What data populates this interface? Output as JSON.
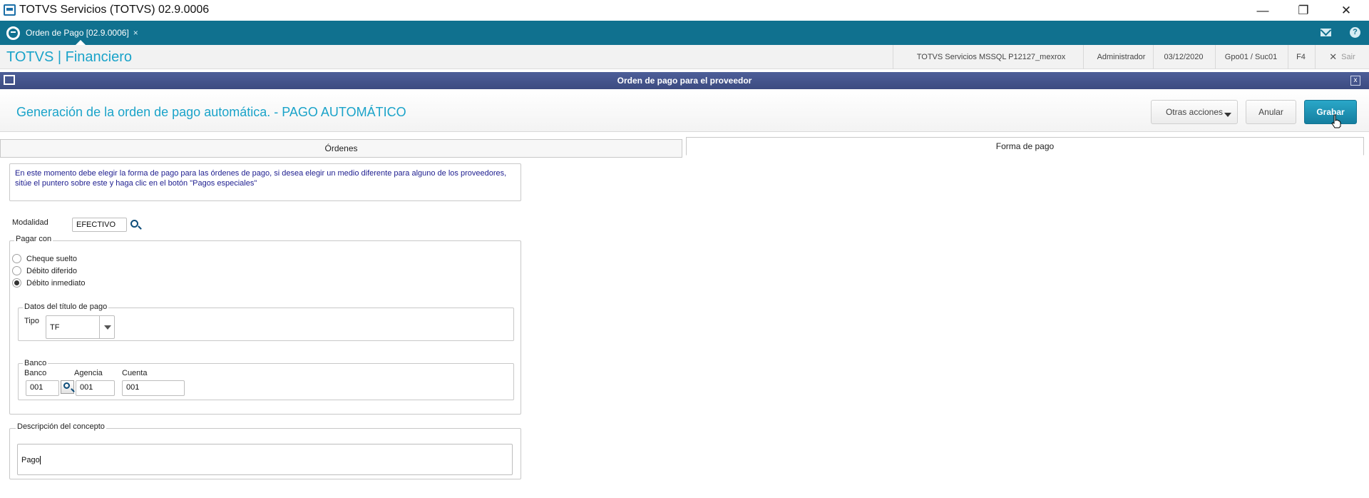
{
  "window": {
    "title": "TOTVS Servicios (TOTVS) 02.9.0006",
    "minimize": "—",
    "restore": "❐",
    "close": "✕"
  },
  "tabbar": {
    "tab_label": "Orden de Pago [02.9.0006]",
    "tab_close": "×",
    "help": "?"
  },
  "module": {
    "brand": "TOTVS | Financiero",
    "env": "TOTVS Servicios MSSQL P12127_mexrox",
    "user": "Administrador",
    "date": "03/12/2020",
    "group": "Gpo01 / Suc01",
    "f4": "F4",
    "exit_icon": "✕",
    "exit": "Sair"
  },
  "dialog": {
    "title": "Orden de pago para el proveedor",
    "close": "x"
  },
  "toolbar": {
    "title": "Generación de la orden de pago automática. - PAGO AUTOMÁTICO",
    "otras": "Otras acciones",
    "anular": "Anular",
    "grabar": "Grabar"
  },
  "tabs": {
    "ordenes": "Órdenes",
    "forma": "Forma de pago"
  },
  "info": {
    "text": "En este momento debe elegir la forma de pago para las órdenes de pago, si desea elegir un medio diferente para alguno de los proveedores, sitúe el puntero sobre este y haga clic en el botón \"Pagos especiales\""
  },
  "modalidad": {
    "label": "Modalidad",
    "value": "EFECTIVO"
  },
  "pagar_con": {
    "title": "Pagar con",
    "options": [
      "Cheque suelto",
      "Débito diferido",
      "Débito inmediato"
    ],
    "selected": "Débito inmediato"
  },
  "titulo": {
    "title": "Datos del título de pago",
    "tipo_label": "Tipo",
    "tipo_value": "TF"
  },
  "banco": {
    "title": "Banco",
    "banco_label": "Banco",
    "banco_value": "001",
    "agencia_label": "Agencia",
    "agencia_value": "001",
    "cuenta_label": "Cuenta",
    "cuenta_value": "001"
  },
  "concepto": {
    "title": "Descripción del concepto",
    "value": "Pago"
  },
  "colors": {
    "accent": "#1aa3c9",
    "tabbar": "#10718f",
    "dialog_header": "#3c4b81",
    "primary_button": "#157fa0"
  }
}
